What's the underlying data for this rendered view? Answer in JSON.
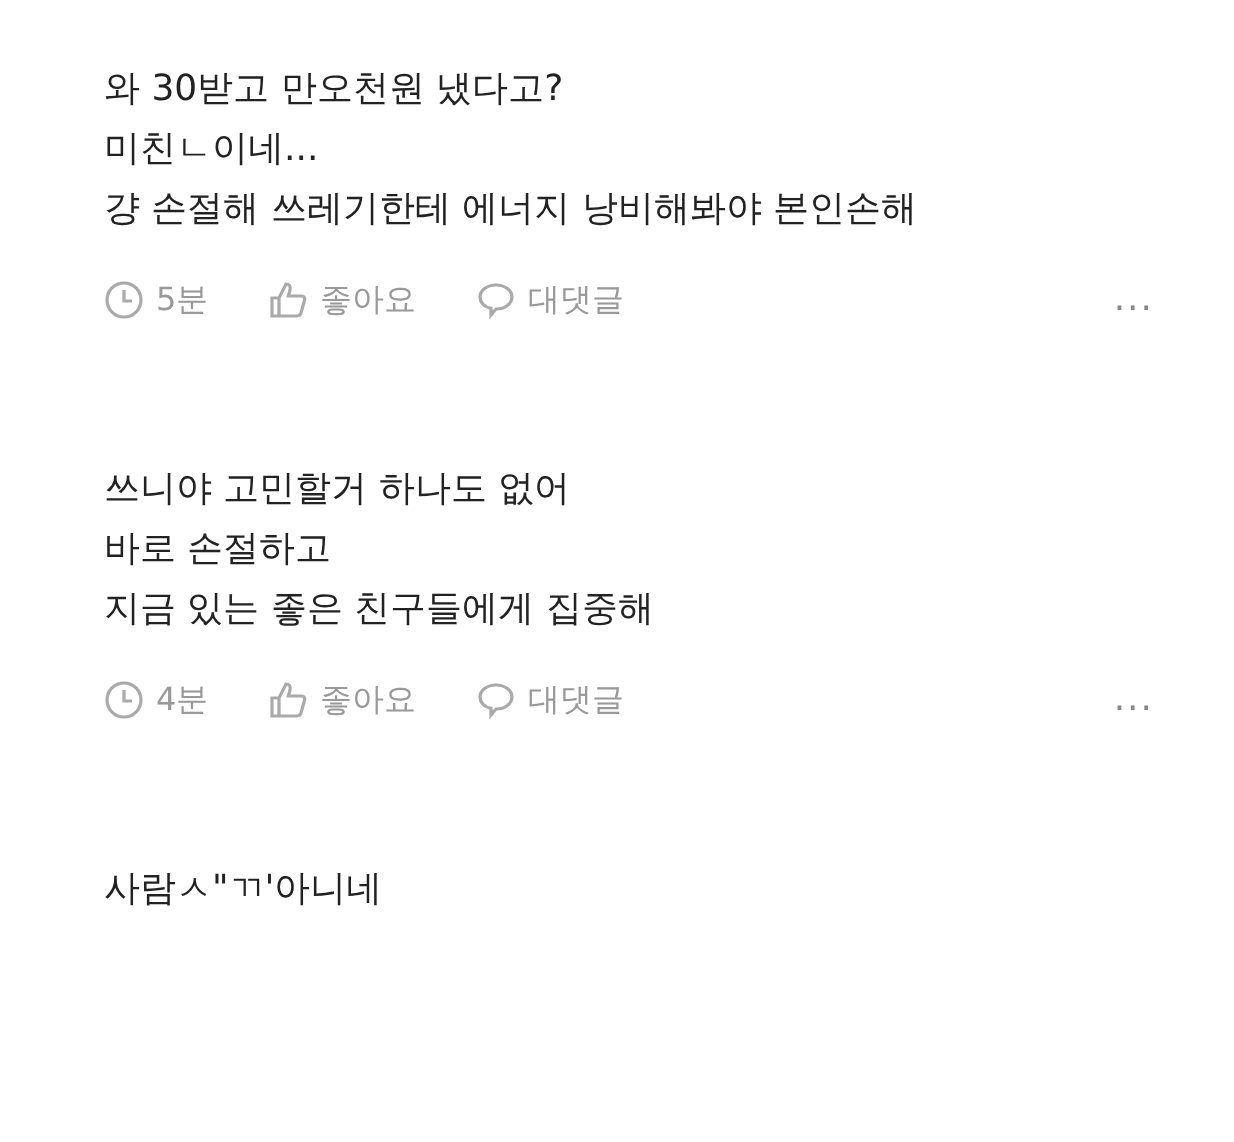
{
  "comments": [
    {
      "lines": [
        "와 30받고 만오천원 냈다고?",
        "미친ㄴ이네...",
        "걍 손절해 쓰레기한테 에너지 낭비해봐야 본인손해"
      ],
      "meta": {
        "time": "5분",
        "like": "좋아요",
        "reply": "대댓글",
        "more": "..."
      }
    },
    {
      "lines": [
        "쓰니야 고민할거 하나도 없어",
        "바로 손절하고",
        "지금 있는 좋은 친구들에게 집중해"
      ],
      "meta": {
        "time": "4분",
        "like": "좋아요",
        "reply": "대댓글",
        "more": "..."
      }
    },
    {
      "lines": [
        "사람ㅅ\"ㄲ'아니네"
      ]
    }
  ]
}
